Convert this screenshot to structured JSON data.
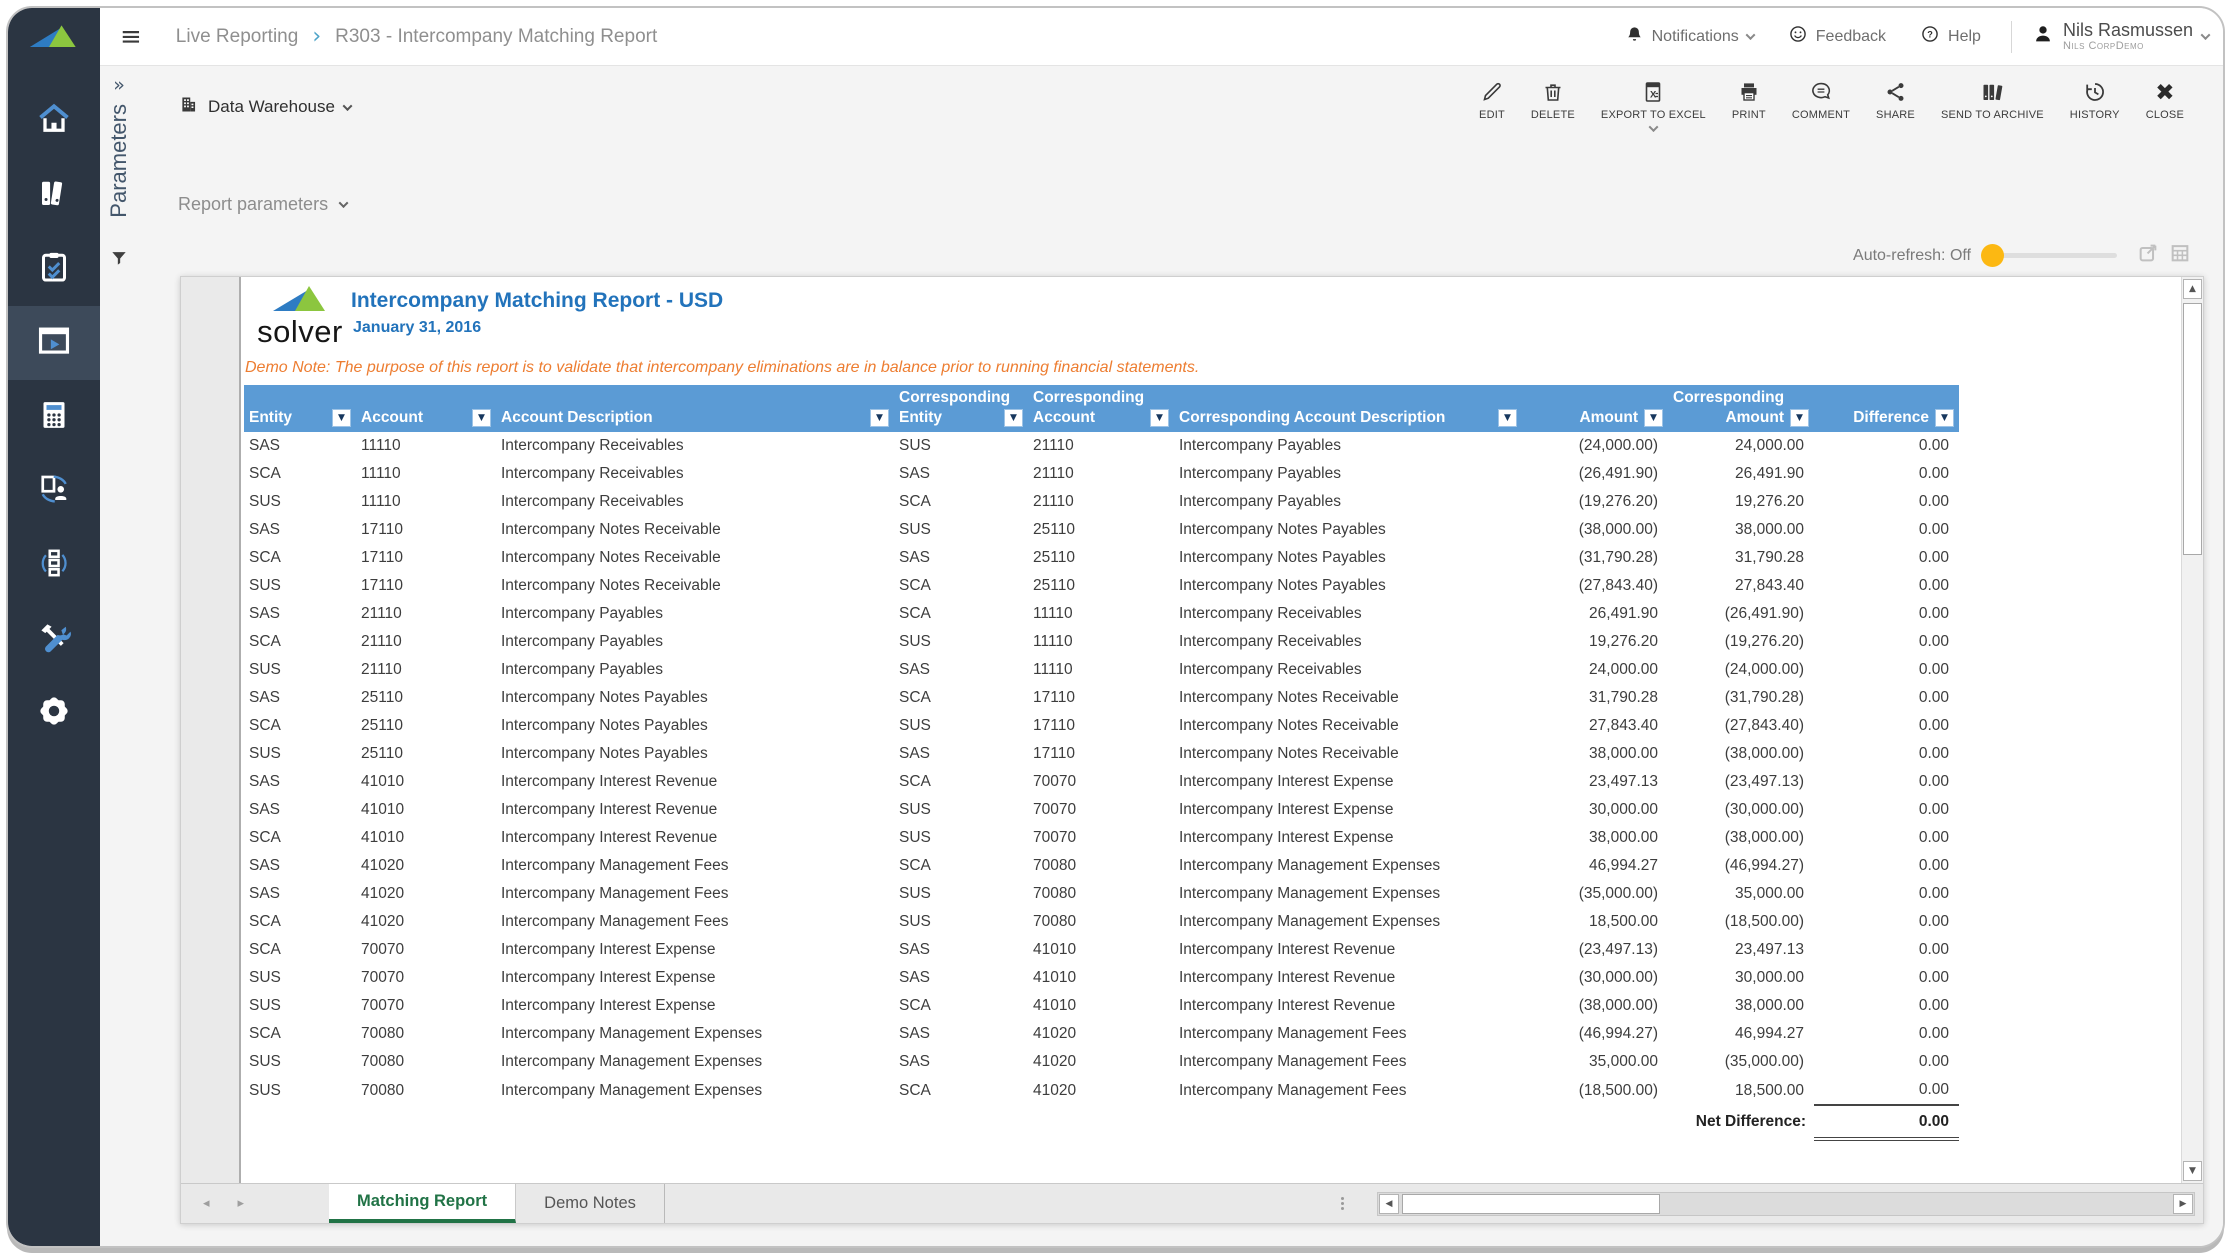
{
  "topbar": {
    "breadcrumb": [
      "Live Reporting",
      "R303 - Intercompany Matching Report"
    ],
    "notifications_label": "Notifications",
    "feedback_label": "Feedback",
    "help_label": "Help",
    "user_name": "Nils Rasmussen",
    "user_org": "Nils CorpDemo"
  },
  "sidebar": {
    "items": [
      "home",
      "archives",
      "tasks",
      "live-reporting",
      "budgeting",
      "collaboration",
      "workflow",
      "tools",
      "settings"
    ],
    "selected": "live-reporting"
  },
  "toolbar": {
    "source_label": "Data Warehouse",
    "buttons": [
      "EDIT",
      "DELETE",
      "EXPORT TO EXCEL",
      "PRINT",
      "COMMENT",
      "SHARE",
      "SEND TO ARCHIVE",
      "HISTORY",
      "CLOSE"
    ]
  },
  "parameters_panel": {
    "label": "Parameters"
  },
  "report_parameters_label": "Report parameters",
  "auto_refresh_label": "Auto-refresh: Off",
  "report": {
    "logo_text": "solver",
    "title": "Intercompany Matching Report - USD",
    "date": "January 31, 2016",
    "demo_note": "Demo Note: The purpose of this report is to validate that intercompany eliminations are in balance prior to running financial statements.",
    "table": {
      "columns": [
        {
          "top": "",
          "label": "Entity"
        },
        {
          "top": "",
          "label": "Account"
        },
        {
          "top": "",
          "label": "Account Description"
        },
        {
          "top": "Corresponding",
          "label": "Entity"
        },
        {
          "top": "Corresponding",
          "label": "Account"
        },
        {
          "top": "",
          "label": "Corresponding Account Description"
        },
        {
          "top": "",
          "label": "Amount"
        },
        {
          "top": "Corresponding",
          "label": "Amount"
        },
        {
          "top": "",
          "label": "Difference"
        }
      ],
      "rows": [
        [
          "SAS",
          "11110",
          "Intercompany Receivables",
          "SUS",
          "21110",
          "Intercompany Payables",
          "(24,000.00)",
          "24,000.00",
          "0.00"
        ],
        [
          "SCA",
          "11110",
          "Intercompany Receivables",
          "SAS",
          "21110",
          "Intercompany Payables",
          "(26,491.90)",
          "26,491.90",
          "0.00"
        ],
        [
          "SUS",
          "11110",
          "Intercompany Receivables",
          "SCA",
          "21110",
          "Intercompany Payables",
          "(19,276.20)",
          "19,276.20",
          "0.00"
        ],
        [
          "SAS",
          "17110",
          "Intercompany Notes Receivable",
          "SUS",
          "25110",
          "Intercompany Notes Payables",
          "(38,000.00)",
          "38,000.00",
          "0.00"
        ],
        [
          "SCA",
          "17110",
          "Intercompany Notes Receivable",
          "SAS",
          "25110",
          "Intercompany Notes Payables",
          "(31,790.28)",
          "31,790.28",
          "0.00"
        ],
        [
          "SUS",
          "17110",
          "Intercompany Notes Receivable",
          "SCA",
          "25110",
          "Intercompany Notes Payables",
          "(27,843.40)",
          "27,843.40",
          "0.00"
        ],
        [
          "SAS",
          "21110",
          "Intercompany Payables",
          "SCA",
          "11110",
          "Intercompany Receivables",
          "26,491.90",
          "(26,491.90)",
          "0.00"
        ],
        [
          "SCA",
          "21110",
          "Intercompany Payables",
          "SUS",
          "11110",
          "Intercompany Receivables",
          "19,276.20",
          "(19,276.20)",
          "0.00"
        ],
        [
          "SUS",
          "21110",
          "Intercompany Payables",
          "SAS",
          "11110",
          "Intercompany Receivables",
          "24,000.00",
          "(24,000.00)",
          "0.00"
        ],
        [
          "SAS",
          "25110",
          "Intercompany Notes Payables",
          "SCA",
          "17110",
          "Intercompany Notes Receivable",
          "31,790.28",
          "(31,790.28)",
          "0.00"
        ],
        [
          "SCA",
          "25110",
          "Intercompany Notes Payables",
          "SUS",
          "17110",
          "Intercompany Notes Receivable",
          "27,843.40",
          "(27,843.40)",
          "0.00"
        ],
        [
          "SUS",
          "25110",
          "Intercompany Notes Payables",
          "SAS",
          "17110",
          "Intercompany Notes Receivable",
          "38,000.00",
          "(38,000.00)",
          "0.00"
        ],
        [
          "SAS",
          "41010",
          "Intercompany Interest Revenue",
          "SCA",
          "70070",
          "Intercompany Interest Expense",
          "23,497.13",
          "(23,497.13)",
          "0.00"
        ],
        [
          "SAS",
          "41010",
          "Intercompany Interest Revenue",
          "SUS",
          "70070",
          "Intercompany Interest Expense",
          "30,000.00",
          "(30,000.00)",
          "0.00"
        ],
        [
          "SCA",
          "41010",
          "Intercompany Interest Revenue",
          "SUS",
          "70070",
          "Intercompany Interest Expense",
          "38,000.00",
          "(38,000.00)",
          "0.00"
        ],
        [
          "SAS",
          "41020",
          "Intercompany Management Fees",
          "SCA",
          "70080",
          "Intercompany Management Expenses",
          "46,994.27",
          "(46,994.27)",
          "0.00"
        ],
        [
          "SAS",
          "41020",
          "Intercompany Management Fees",
          "SUS",
          "70080",
          "Intercompany Management Expenses",
          "(35,000.00)",
          "35,000.00",
          "0.00"
        ],
        [
          "SCA",
          "41020",
          "Intercompany Management Fees",
          "SUS",
          "70080",
          "Intercompany Management Expenses",
          "18,500.00",
          "(18,500.00)",
          "0.00"
        ],
        [
          "SCA",
          "70070",
          "Intercompany Interest Expense",
          "SAS",
          "41010",
          "Intercompany Interest Revenue",
          "(23,497.13)",
          "23,497.13",
          "0.00"
        ],
        [
          "SUS",
          "70070",
          "Intercompany Interest Expense",
          "SAS",
          "41010",
          "Intercompany Interest Revenue",
          "(30,000.00)",
          "30,000.00",
          "0.00"
        ],
        [
          "SUS",
          "70070",
          "Intercompany Interest Expense",
          "SCA",
          "41010",
          "Intercompany Interest Revenue",
          "(38,000.00)",
          "38,000.00",
          "0.00"
        ],
        [
          "SCA",
          "70080",
          "Intercompany Management Expenses",
          "SAS",
          "41020",
          "Intercompany Management Fees",
          "(46,994.27)",
          "46,994.27",
          "0.00"
        ],
        [
          "SUS",
          "70080",
          "Intercompany Management Expenses",
          "SAS",
          "41020",
          "Intercompany Management Fees",
          "35,000.00",
          "(35,000.00)",
          "0.00"
        ],
        [
          "SUS",
          "70080",
          "Intercompany Management Expenses",
          "SCA",
          "41020",
          "Intercompany Management Fees",
          "(18,500.00)",
          "18,500.00",
          "0.00"
        ]
      ],
      "net_difference_label": "Net Difference:",
      "net_difference_value": "0.00"
    },
    "tabs": [
      "Matching Report",
      "Demo Notes"
    ],
    "active_tab": "Matching Report"
  },
  "colors": {
    "header_blue": "#5B9BD5",
    "title_blue": "#2273BB",
    "note_orange": "#ED7D31",
    "tab_green": "#217346",
    "knob_amber": "#FCB812",
    "sidebar_bg": "#2B3542",
    "logo_blue": "#2E7CC3",
    "logo_green": "#8CC63F"
  }
}
